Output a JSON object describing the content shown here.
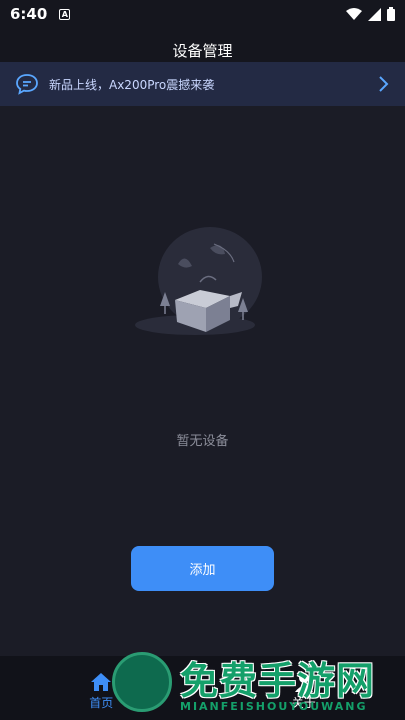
{
  "status_bar": {
    "time": "6:40",
    "notification_icon_letter": "A"
  },
  "header": {
    "title": "设备管理"
  },
  "banner": {
    "text": "新品上线，Ax200Pro震撼来袭"
  },
  "empty_state": {
    "text": "暂无设备"
  },
  "add_button": {
    "label": "添加"
  },
  "tabs": [
    {
      "label": "首页",
      "icon": "home-icon",
      "active": true
    },
    {
      "label": "关于",
      "icon": "person-icon",
      "active": false
    }
  ],
  "watermark": {
    "title": "免费手游网",
    "subtitle": "MIANFEISHOUYOUWANG"
  },
  "colors": {
    "accent": "#3e8ef7",
    "background": "#1b1c26",
    "banner": "#232a44"
  }
}
